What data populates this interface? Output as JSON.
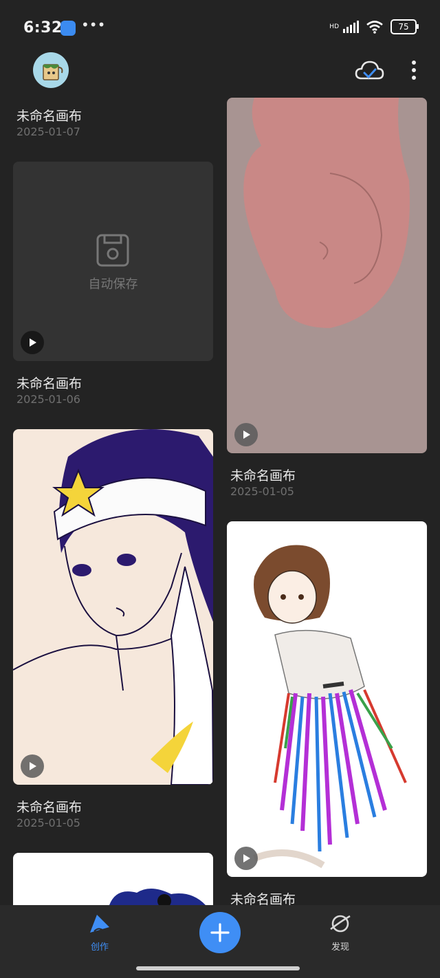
{
  "status": {
    "time": "6:32",
    "dots": "•••",
    "hd": "HD",
    "battery": "75"
  },
  "topbar": {
    "cloud_icon": "cloud-check-icon",
    "more_icon": "more-vertical-icon"
  },
  "canvases": [
    {
      "title": "未命名画布",
      "date": "2025-01-07"
    },
    {
      "title": "未命名画布",
      "date": "2025-01-06",
      "placeholder": "自动保存"
    },
    {
      "title": "未命名画布",
      "date": "2025-01-05"
    },
    {
      "title": "未命名画布",
      "date": "2025-01-05"
    },
    {
      "title": "未命名画布",
      "date": ""
    }
  ],
  "nav": {
    "create_label": "创作",
    "discover_label": "发现",
    "accent": "#3f8ef5"
  }
}
